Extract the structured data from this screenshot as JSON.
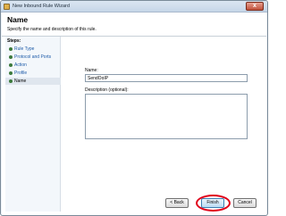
{
  "window": {
    "title": "New Inbound Rule Wizard",
    "close_glyph": "x"
  },
  "header": {
    "title": "Name",
    "subtitle": "Specify the name and description of this rule."
  },
  "steps": {
    "heading": "Steps:",
    "items": [
      {
        "label": "Rule Type",
        "state": "completed"
      },
      {
        "label": "Protocol and Ports",
        "state": "completed"
      },
      {
        "label": "Action",
        "state": "completed"
      },
      {
        "label": "Profile",
        "state": "completed"
      },
      {
        "label": "Name",
        "state": "current"
      }
    ]
  },
  "form": {
    "name_label": "Name:",
    "name_value": "SendOoIP",
    "description_label": "Description (optional):",
    "description_value": ""
  },
  "buttons": {
    "back": "< Back",
    "finish": "Finish",
    "cancel": "Cancel"
  },
  "colors": {
    "step_done_dot": "#3c7a3c",
    "link_text": "#1c5aa8",
    "highlight_ring": "#e0001a"
  }
}
